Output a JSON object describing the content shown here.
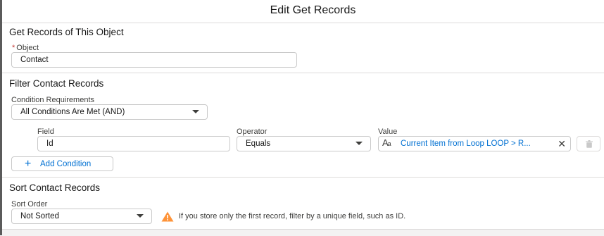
{
  "modal": {
    "title": "Edit Get Records"
  },
  "object_section": {
    "title": "Get Records of This Object",
    "object_label": "Object",
    "required_marker": "*",
    "object_value": "Contact"
  },
  "filter_section": {
    "title": "Filter Contact Records",
    "condition_requirements_label": "Condition Requirements",
    "condition_requirements_value": "All Conditions Are Met (AND)",
    "columns": {
      "field": "Field",
      "operator": "Operator",
      "value": "Value"
    },
    "condition": {
      "field": "Id",
      "operator": "Equals",
      "value_icon": "text-type-icon",
      "value": "Current Item from Loop LOOP > R..."
    },
    "add_condition_label": "Add Condition"
  },
  "sort_section": {
    "title": "Sort Contact Records",
    "sort_order_label": "Sort Order",
    "sort_order_value": "Not Sorted",
    "warning_text": "If you store only the first record, filter by a unique field, such as ID."
  },
  "colors": {
    "link": "#0070d2",
    "warning": "#fe9339",
    "required": "#c23934",
    "border": "#c9c9c9"
  }
}
